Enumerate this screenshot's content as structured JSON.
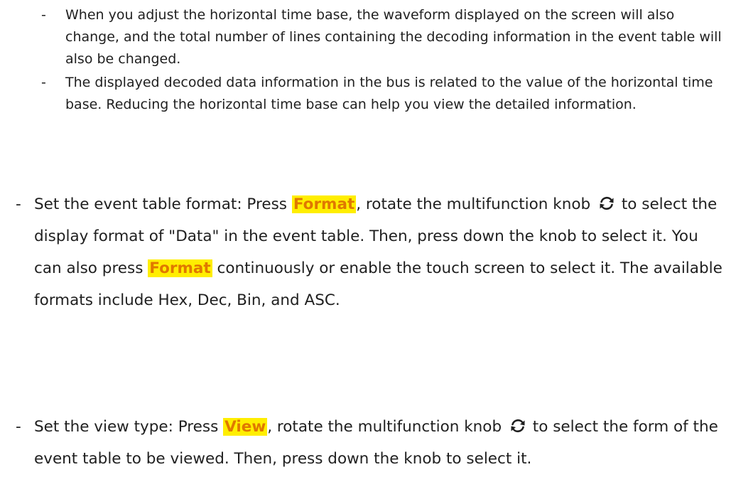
{
  "bullets_sub": [
    {
      "dash": "-",
      "text": "When you adjust the horizontal time base, the waveform displayed on the screen will also change, and the total number of lines containing the decoding information in the event table will also be changed."
    },
    {
      "dash": "-",
      "text": "The displayed decoded data information in the bus is related to the value of the horizontal time base. Reducing the horizontal time base can help you view the detailed information."
    }
  ],
  "bullet_format": {
    "dash": "-",
    "part1": "Set the event table format: Press ",
    "key1": "Format",
    "part2": ", rotate the multifunction knob ",
    "icon": "rotate-knob-icon",
    "part3": " to select the display format of \"Data\" in the event table. Then, press down the knob to select it. You can also press ",
    "key2": "Format",
    "part4": " continuously or enable the touch screen to select it. The available formats include Hex, Dec, Bin, and ASC."
  },
  "bullet_view": {
    "dash": "-",
    "part1": "Set the view type: Press ",
    "key1": "View",
    "part2": ", rotate the multifunction knob ",
    "icon": "rotate-knob-icon",
    "part3": " to select the form of the event table to be viewed. Then, press down the knob to select it."
  },
  "colors": {
    "highlight_bg": "#ffee00",
    "key_text": "#e07800",
    "body_text": "#1f1f1f"
  }
}
